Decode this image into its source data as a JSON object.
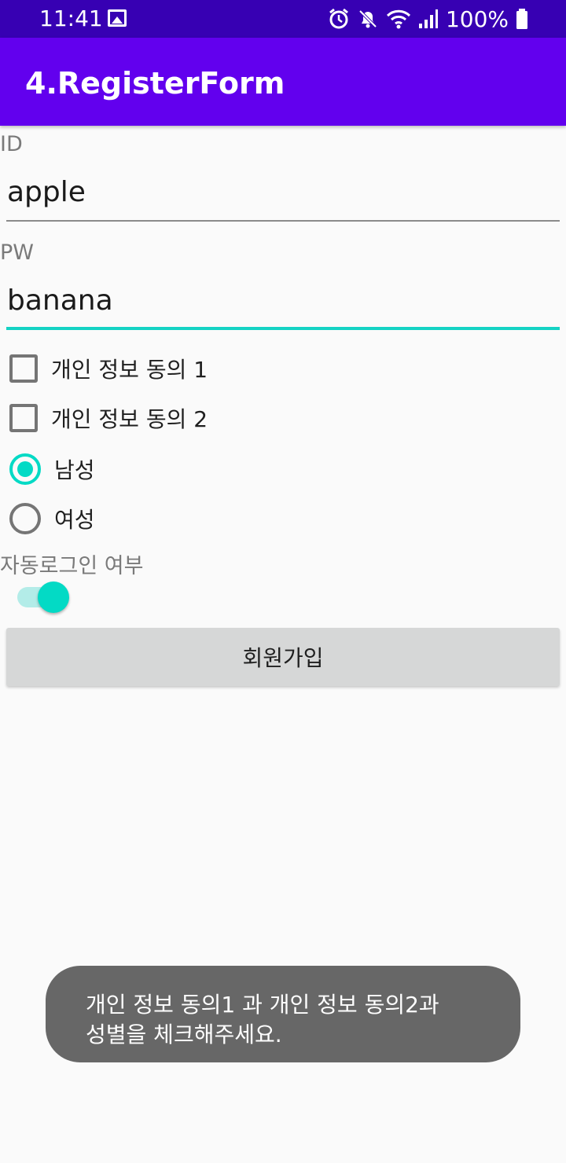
{
  "status_bar": {
    "time": "11:41",
    "battery": "100%",
    "left_icons": [
      "image-icon"
    ],
    "right_icons": [
      "alarm-icon",
      "mute-icon",
      "wifi-icon",
      "signal-icon",
      "battery-icon"
    ]
  },
  "app_bar": {
    "title": "4.RegisterForm",
    "color": "#6200ee"
  },
  "form": {
    "id_label": "ID",
    "id_value": "apple",
    "pw_label": "PW",
    "pw_value": "banana",
    "checkboxes": [
      {
        "label": "개인 정보 동의 1",
        "checked": false
      },
      {
        "label": "개인 정보 동의 2",
        "checked": false
      }
    ],
    "radios": [
      {
        "label": "남성",
        "checked": true
      },
      {
        "label": "여성",
        "checked": false
      }
    ],
    "autologin_label": "자동로그인 여부",
    "autologin_on": true,
    "submit_label": "회원가입"
  },
  "toast": {
    "line1": "개인 정보 동의1 과 개인 정보 동의2과",
    "line2": "성별을 체크해주세요."
  },
  "colors": {
    "status_bar": "#3700b3",
    "accent": "#03dac5",
    "button": "#d6d7d7",
    "toast": "#676767"
  }
}
